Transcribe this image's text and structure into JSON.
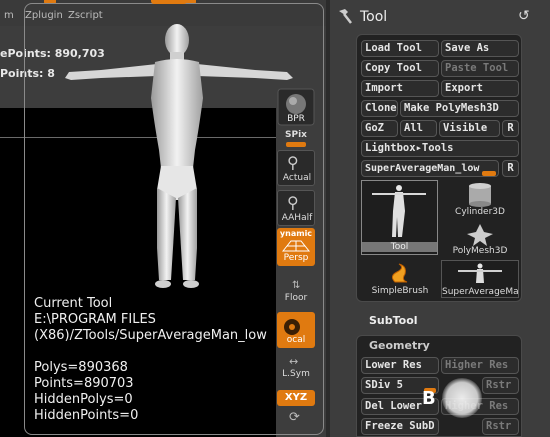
{
  "menu": {
    "items": [
      "m",
      "Zplugin",
      "Zscript"
    ]
  },
  "stats": {
    "points_line": "ePoints: 890,703",
    "points_line2": "Points: 8"
  },
  "info": {
    "title": "Current Tool",
    "path1": "E:\\PROGRAM FILES",
    "path2": "(X86)/ZTools/SuperAverageMan_low",
    "polys": "Polys=890368",
    "points": "Points=890703",
    "hidden_polys": "HiddenPolys=0",
    "hidden_points": "HiddenPoints=0"
  },
  "right_tools": {
    "bpr": "BPR",
    "spix": "SPix",
    "actual": "Actual",
    "aahalf": "AAHalf",
    "dynamic": "ynamic",
    "persp": "Persp",
    "floor": "Floor",
    "local": "ocal",
    "lsym": "L.Sym",
    "xyz": "XYZ"
  },
  "panel": {
    "title": "Tool",
    "buttons": {
      "load_tool": "Load Tool",
      "save_as": "Save As",
      "copy_tool": "Copy Tool",
      "paste_tool": "Paste Tool",
      "import": "Import",
      "export": "Export",
      "clone": "Clone",
      "make_polymesh": "Make PolyMesh3D",
      "goz": "GoZ",
      "all": "All",
      "visible": "Visible",
      "r1": "R",
      "lightbox": "Lightbox▸Tools",
      "current_tool": "SuperAverageMan_low",
      "r2": "R"
    },
    "thumbs": {
      "tool": "Tool",
      "cylinder": "Cylinder3D",
      "polymesh": "PolyMesh3D",
      "simplebrush": "SimpleBrush",
      "superavg": "SuperAverageMa"
    },
    "subtool": "SubTool",
    "geometry": {
      "header": "Geometry",
      "lower_res": "Lower Res",
      "higher_res": "Higher Res",
      "sdiv": "SDiv 5",
      "rstr": "Rstr",
      "del_lower": "Del Lower",
      "del_higher": "Higher Res",
      "freeze": "Freeze SubD",
      "rstr2": "Rstr"
    },
    "sdiv_level": 1.0
  },
  "cursor_letter": "B",
  "colors": {
    "accent": "#e07a10",
    "panel": "#3d3d3d",
    "button": "#2c2c2c"
  }
}
